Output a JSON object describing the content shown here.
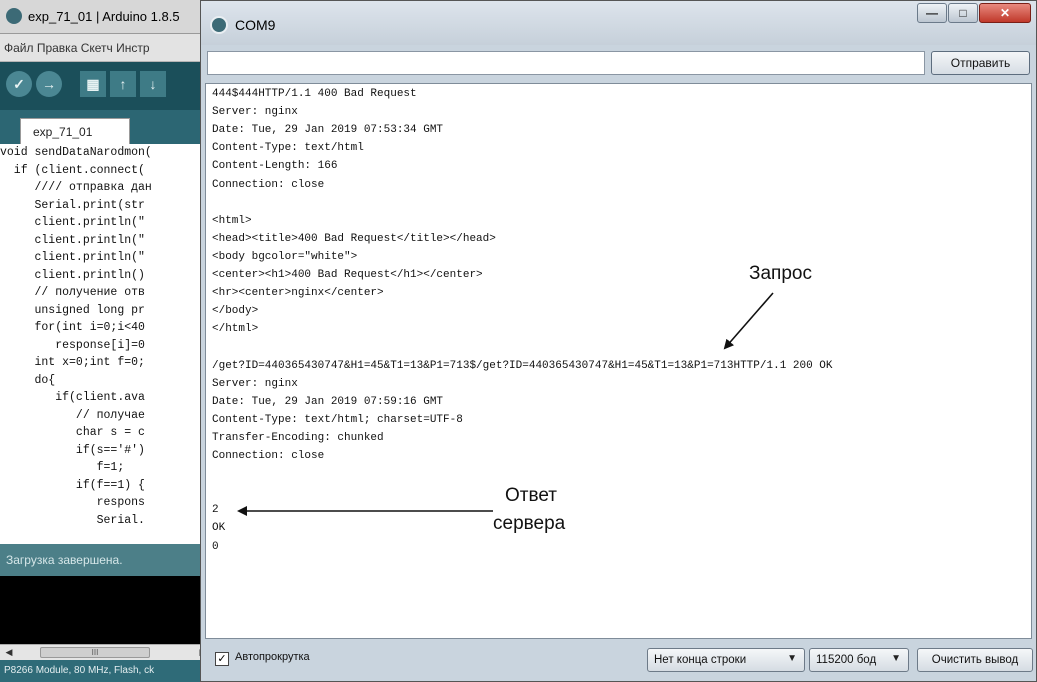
{
  "ide": {
    "title": "exp_71_01 | Arduino 1.8.5",
    "menu": "Файл  Правка  Скетч  Инстр",
    "toolbar": [
      "✓",
      "→",
      "▦",
      "↑",
      "↓"
    ],
    "tab": "exp_71_01",
    "code_lines": [
      "void sendDataNarodmon(",
      "  if (client.connect(",
      "     //// отправка дан",
      "     Serial.print(str",
      "     client.println(\"",
      "     client.println(\"",
      "     client.println(\"",
      "     client.println()",
      "     // получение отв",
      "     unsigned long pr",
      "     for(int i=0;i<40",
      "        response[i]=0",
      "     int x=0;int f=0;",
      "     do{",
      "        if(client.ava",
      "           // получае",
      "           char s = c",
      "           if(s=='#')",
      "              f=1;",
      "           if(f==1) {",
      "              respons",
      "              Serial."
    ],
    "status": "Загрузка завершена.",
    "scroll_grip": "III",
    "board": "P8266 Module, 80 MHz, Flash, ck"
  },
  "serial": {
    "title": "COM9",
    "window_buttons": {
      "minimize": "—",
      "maximize": "□",
      "close": "✕"
    },
    "send_input_value": "",
    "send_button": "Отправить",
    "output_lines": [
      "444$444HTTP/1.1 400 Bad Request",
      "Server: nginx",
      "Date: Tue, 29 Jan 2019 07:53:34 GMT",
      "Content-Type: text/html",
      "Content-Length: 166",
      "Connection: close",
      "",
      "<html>",
      "<head><title>400 Bad Request</title></head>",
      "<body bgcolor=\"white\">",
      "<center><h1>400 Bad Request</h1></center>",
      "<hr><center>nginx</center>",
      "</body>",
      "</html>",
      "",
      "/get?ID=440365430747&H1=45&T1=13&P1=713$/get?ID=440365430747&H1=45&T1=13&P1=713HTTP/1.1 200 OK",
      "Server: nginx",
      "Date: Tue, 29 Jan 2019 07:59:16 GMT",
      "Content-Type: text/html; charset=UTF-8",
      "Transfer-Encoding: chunked",
      "Connection: close",
      "",
      "",
      "2",
      "OK",
      "0"
    ],
    "annotation_request": "Запрос",
    "annotation_response_1": "Ответ",
    "annotation_response_2": "сервера",
    "autoscroll_label": "Автопрокрутка",
    "autoscroll_checked": "✓",
    "line_ending": "Нет конца строки",
    "baud": "115200 бод",
    "clear_button": "Очистить вывод",
    "dropdown_caret": "▼"
  }
}
